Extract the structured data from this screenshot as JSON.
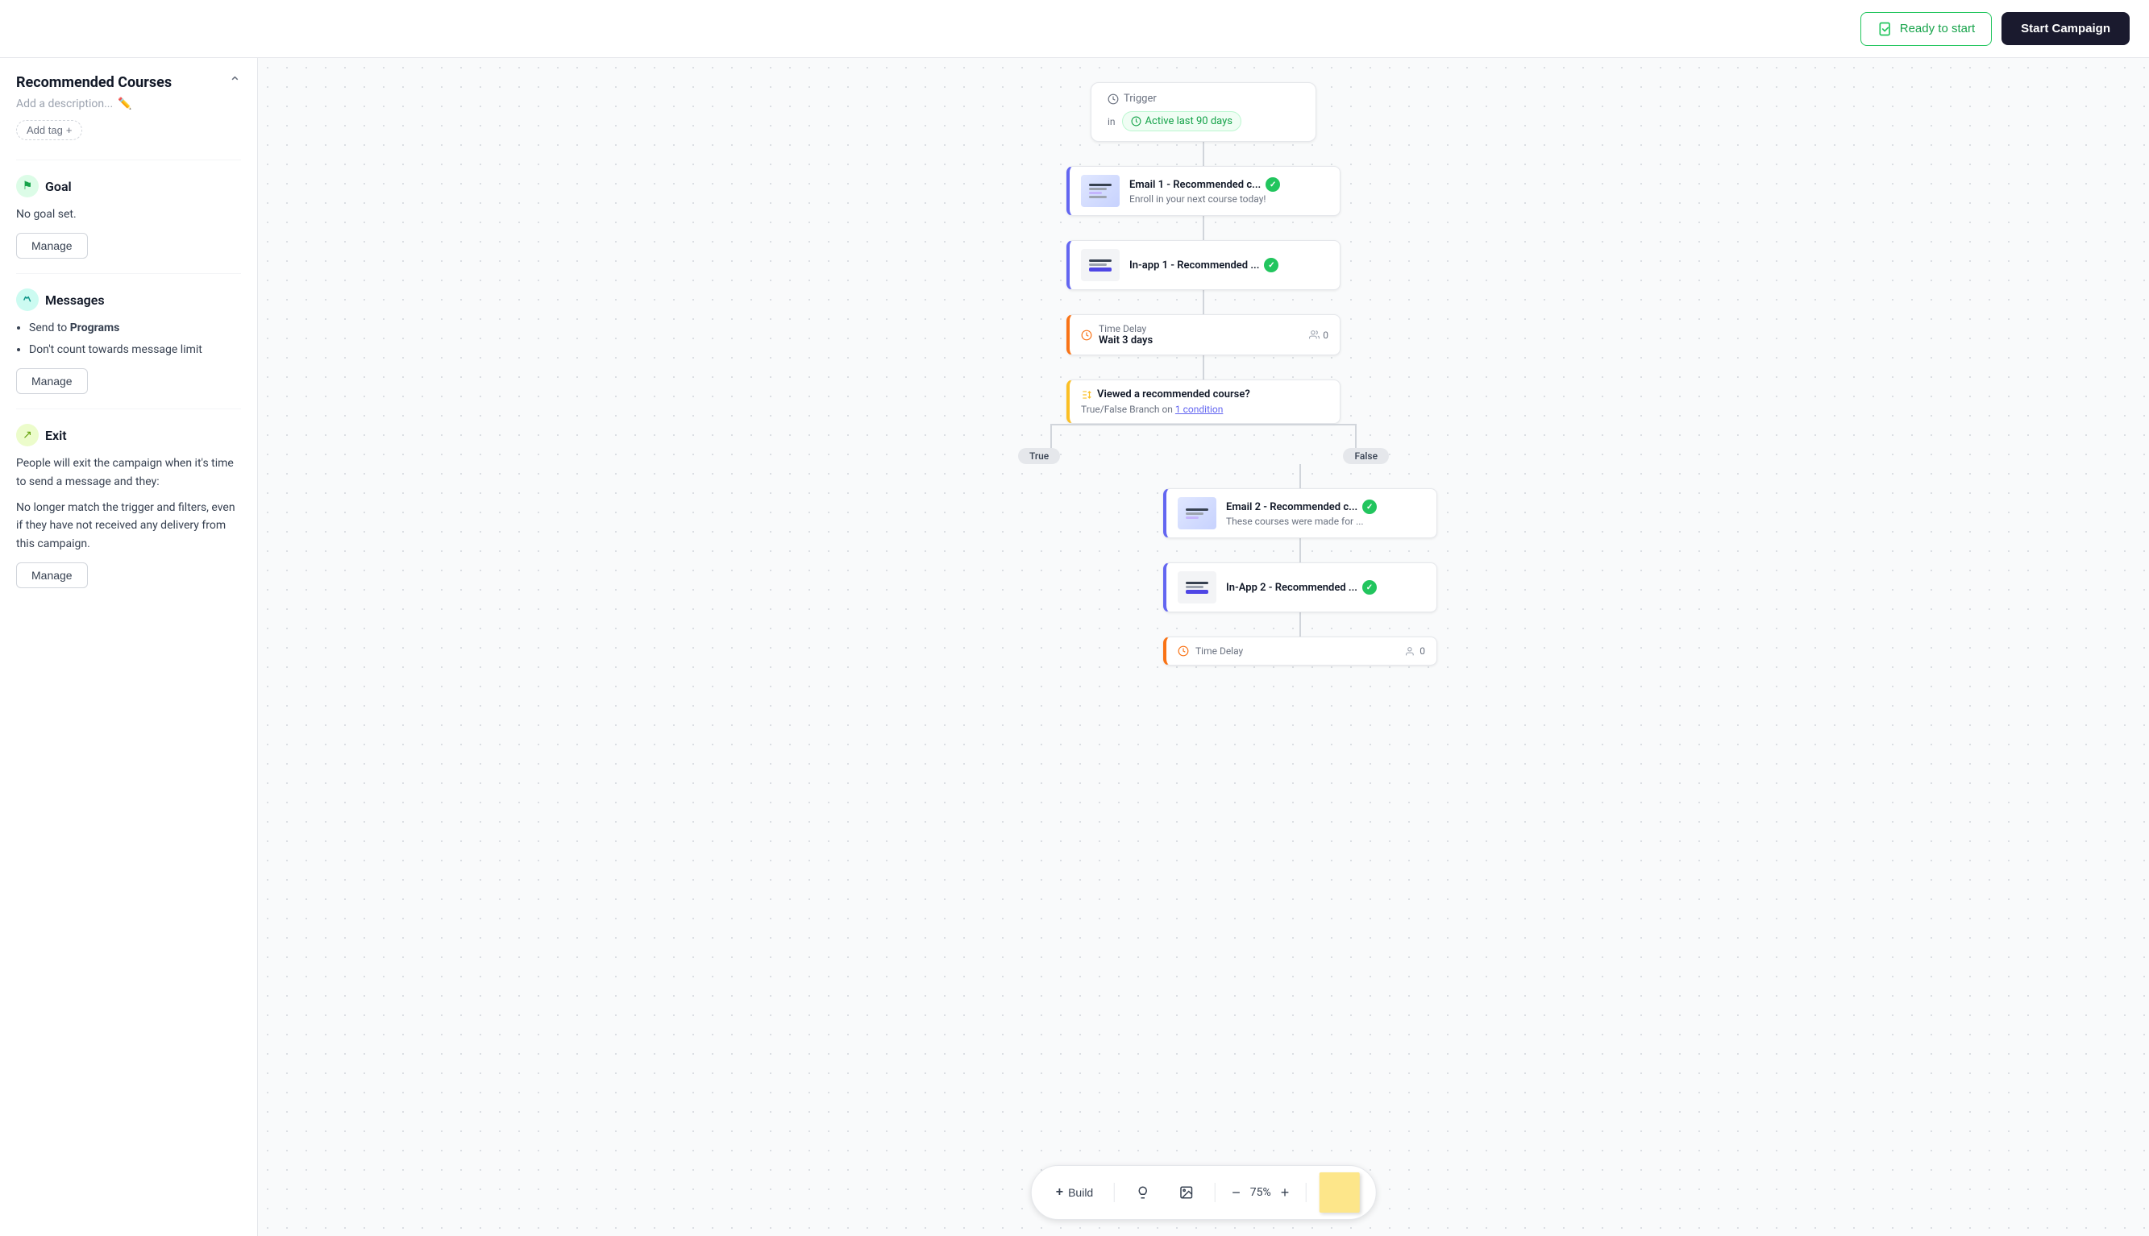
{
  "header": {
    "ready_label": "Ready to start",
    "start_btn": "Start Campaign"
  },
  "sidebar": {
    "title": "Recommended Courses",
    "description_placeholder": "Add a description...",
    "add_tag_label": "Add tag",
    "goal_section": {
      "title": "Goal",
      "icon": "🎯",
      "no_goal_text": "No goal set.",
      "manage_label": "Manage"
    },
    "messages_section": {
      "title": "Messages",
      "icon": "✉",
      "bullet1_prefix": "Send to ",
      "bullet1_bold": "Programs",
      "bullet2": "Don't count towards message limit",
      "manage_label": "Manage"
    },
    "exit_section": {
      "title": "Exit",
      "icon": "↗",
      "description1": "People will exit the campaign when it's time to send a message and they:",
      "description2": "No longer match the trigger and filters, even if they have not received any delivery from this campaign.",
      "manage_label": "Manage"
    }
  },
  "canvas": {
    "trigger": {
      "label": "Trigger",
      "filter_label": "in",
      "filter_badge": "Active last 90 days"
    },
    "email1": {
      "title": "Email 1 - Recommended c...",
      "subtitle": "Enroll in your next course today!"
    },
    "inapp1": {
      "title": "In-app 1 - Recommended ...",
      "subtitle": ""
    },
    "time_delay1": {
      "label": "Time Delay",
      "value": "Wait 3 days",
      "audience": "0"
    },
    "branch": {
      "title": "Viewed a recommended course?",
      "subtitle_prefix": "True/False Branch on ",
      "condition_link": "1 condition"
    },
    "branch_true": "True",
    "branch_false": "False",
    "email2": {
      "title": "Email 2 - Recommended c...",
      "subtitle": "These courses were made for ..."
    },
    "inapp2": {
      "title": "In-App 2 - Recommended ...",
      "subtitle": ""
    },
    "time_delay2": {
      "label": "Time Delay",
      "audience": "0"
    }
  },
  "toolbar": {
    "build_label": "Build",
    "zoom_level": "75%",
    "build_icon": "+",
    "zoom_in_icon": "+",
    "zoom_out_icon": "−"
  }
}
